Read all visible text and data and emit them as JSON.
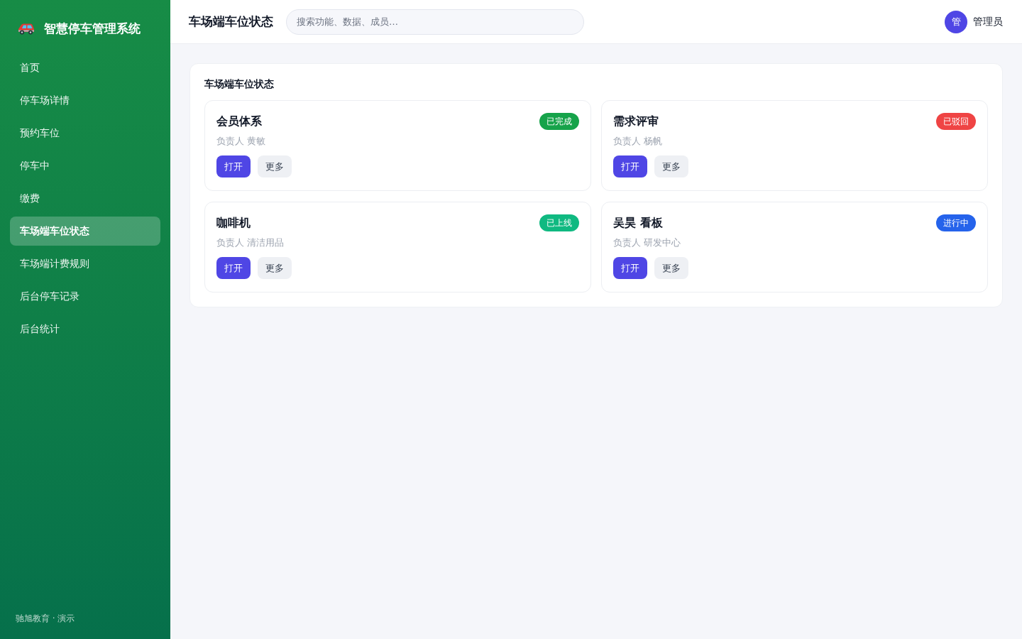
{
  "sidebar": {
    "logo_title": "智慧停车管理系统",
    "items": [
      {
        "label": "首页",
        "selected": false
      },
      {
        "label": "停车场详情",
        "selected": false
      },
      {
        "label": "预约车位",
        "selected": false
      },
      {
        "label": "停车中",
        "selected": false
      },
      {
        "label": "缴费",
        "selected": false
      },
      {
        "label": "车场端车位状态",
        "selected": true
      },
      {
        "label": "车场端计费规则",
        "selected": false
      },
      {
        "label": "后台停车记录",
        "selected": false
      },
      {
        "label": "后台统计",
        "selected": false
      }
    ],
    "footer": "驰旭教育 · 演示"
  },
  "header": {
    "title": "车场端车位状态",
    "search": {
      "placeholder": "搜索功能、数据、成员…"
    },
    "user": {
      "avatar": "管",
      "name": "管理员"
    }
  },
  "panel": {
    "title": "车场端车位状态",
    "cards": [
      {
        "title": "会员体系",
        "status": {
          "label": "已完成",
          "color": "#16a34a"
        },
        "owner": "负责人 黄敏",
        "buttons": [
          {
            "label": "打开",
            "kind": "primary"
          },
          {
            "label": "更多",
            "kind": "secondary"
          }
        ]
      },
      {
        "title": "需求评审",
        "status": {
          "label": "已驳回",
          "color": "#ef4444"
        },
        "owner": "负责人 杨帆",
        "buttons": [
          {
            "label": "打开",
            "kind": "primary"
          },
          {
            "label": "更多",
            "kind": "secondary"
          }
        ]
      },
      {
        "title": "咖啡机",
        "status": {
          "label": "已上线",
          "color": "#10b981"
        },
        "owner": "负责人 清洁用品",
        "buttons": [
          {
            "label": "打开",
            "kind": "primary"
          },
          {
            "label": "更多",
            "kind": "secondary"
          }
        ]
      },
      {
        "title": "吴昊 看板",
        "status": {
          "label": "进行中",
          "color": "#2563eb"
        },
        "owner": "负责人 研发中心",
        "buttons": [
          {
            "label": "打开",
            "kind": "primary"
          },
          {
            "label": "更多",
            "kind": "secondary"
          }
        ]
      }
    ]
  }
}
